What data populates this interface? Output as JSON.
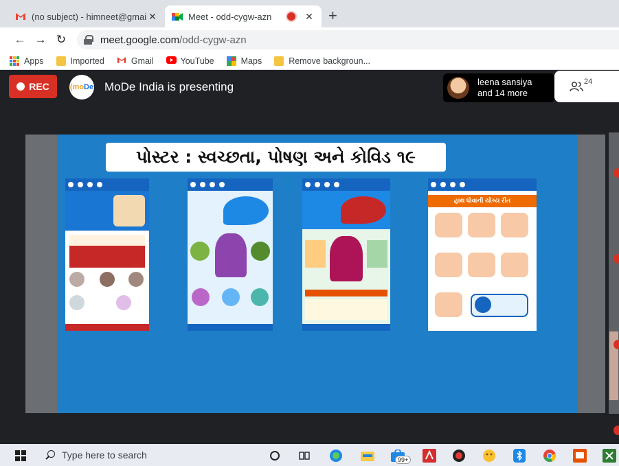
{
  "tabs": [
    {
      "title": "(no subject) - himneet@gmail.co",
      "icon": "gmail-icon"
    },
    {
      "title": "Meet - odd-cygw-azn",
      "icon": "meet-icon",
      "recording": true
    }
  ],
  "address": {
    "domain": "meet.google.com",
    "path": "/odd-cygw-azn"
  },
  "bookmarks": [
    {
      "label": "Apps",
      "icon": "apps-grid-icon"
    },
    {
      "label": "Imported",
      "icon": "folder-icon"
    },
    {
      "label": "Gmail",
      "icon": "gmail-icon"
    },
    {
      "label": "YouTube",
      "icon": "youtube-icon"
    },
    {
      "label": "Maps",
      "icon": "maps-icon"
    },
    {
      "label": "Remove backgroun...",
      "icon": "folder-icon"
    }
  ],
  "meet": {
    "rec_label": "REC",
    "logo_text_1": "(mo",
    "logo_text_2": "De",
    "presenting": "MoDe India is presenting",
    "participant_name": "leena sansiya",
    "participant_more": "and 14 more",
    "people_count": "24"
  },
  "slide": {
    "title": "પોસ્ટર : સ્વચ્છતા, પોષણ અને કોવિડ ૧૯",
    "poster_4_heading": "હાથ ધોવાની યોગ્ય રીત"
  },
  "taskbar": {
    "search_placeholder": "Type here to search",
    "badge": "99+"
  },
  "colors": {
    "tabstrip": "#dee1e6",
    "rec_red": "#d93025",
    "slide_blue": "#1e7fc8",
    "poster_blue": "#1565c0"
  }
}
